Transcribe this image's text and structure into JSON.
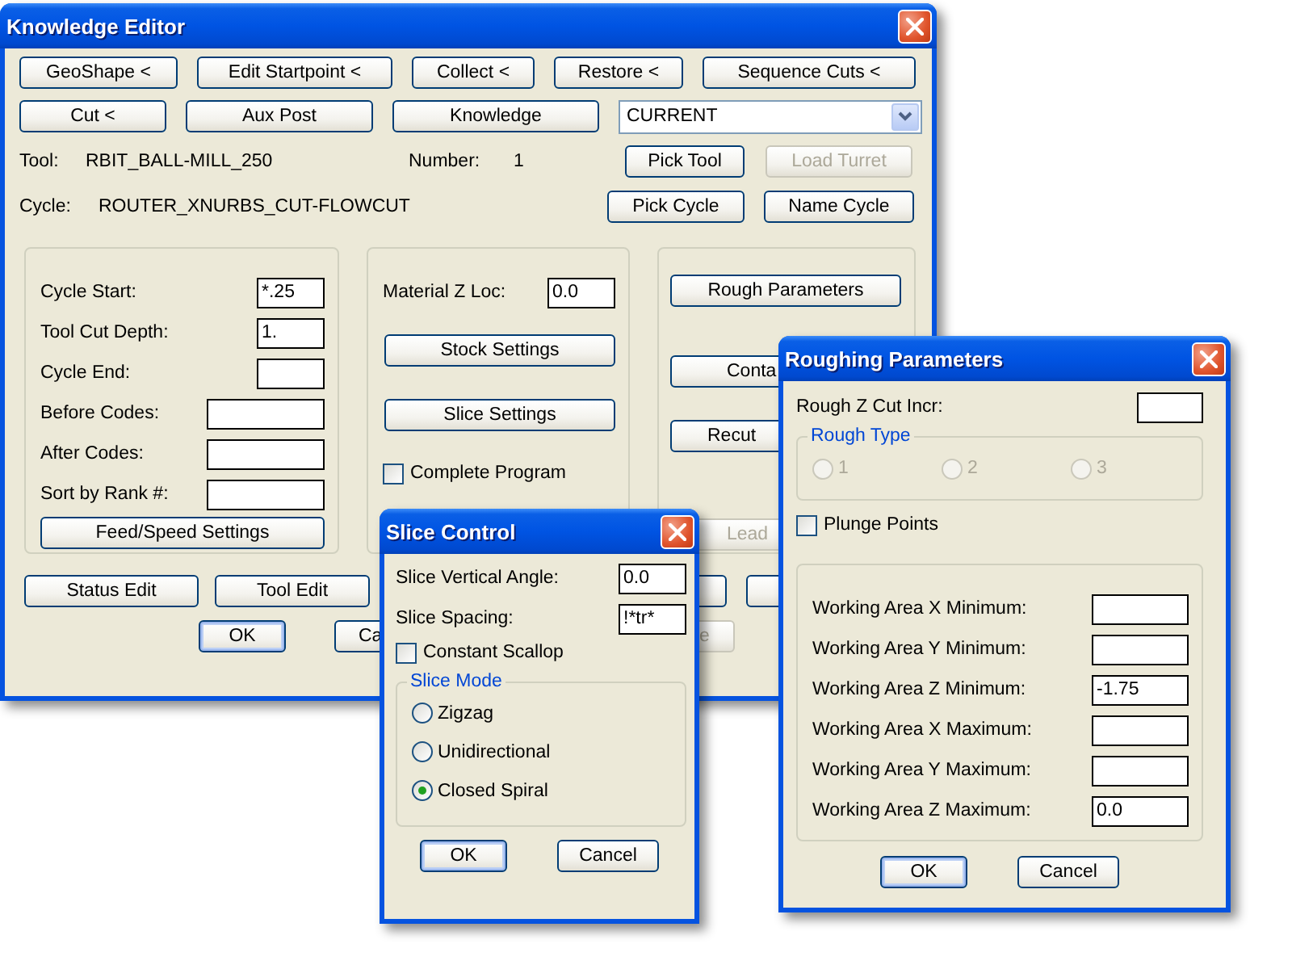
{
  "knowledge_editor": {
    "title": "Knowledge Editor",
    "button_row_1": [
      {
        "label": "GeoShape <"
      },
      {
        "label": "Edit Startpoint <"
      },
      {
        "label": "Collect <"
      },
      {
        "label": "Restore <"
      },
      {
        "label": "Sequence Cuts <"
      }
    ],
    "button_row_2": [
      {
        "label": "Cut <"
      },
      {
        "label": "Aux Post"
      },
      {
        "label": "Knowledge"
      }
    ],
    "mode_dropdown": {
      "value": "CURRENT"
    },
    "tool_row": {
      "label": "Tool:",
      "value": "RBIT_BALL-MILL_250",
      "number_label": "Number:",
      "number": "1",
      "buttons": [
        {
          "label": "Pick Tool",
          "disabled": false
        },
        {
          "label": "Load Turret",
          "disabled": true
        }
      ]
    },
    "cycle_row": {
      "label": "Cycle:",
      "value": "ROUTER_XNURBS_CUT-FLOWCUT",
      "buttons": [
        {
          "label": "Pick Cycle",
          "disabled": false
        },
        {
          "label": "Name Cycle",
          "disabled": false
        }
      ]
    },
    "cycle_fields": [
      {
        "label": "Cycle Start:",
        "value": "*.25"
      },
      {
        "label": "Tool Cut Depth:",
        "value": "1."
      },
      {
        "label": "Cycle End:"
      },
      {
        "label": "Before Codes:"
      },
      {
        "label": "After Codes:"
      },
      {
        "label": "Sort by Rank #:"
      }
    ],
    "feed_speed_button": "Feed/Speed Settings",
    "material_z": {
      "label": "Material Z Loc:",
      "value": "0.0"
    },
    "settings_buttons": [
      "Stock Settings",
      "Slice Settings"
    ],
    "complete_program": {
      "label": "Complete Program",
      "checked": false
    },
    "parameter_buttons": [
      {
        "label": "Rough Parameters",
        "disabled": false
      },
      {
        "label": "Conta",
        "disabled": false
      },
      {
        "label": "Recut",
        "disabled": false
      },
      {
        "label": "Lead",
        "disabled": true
      }
    ],
    "bottom_buttons": [
      {
        "label": "Status Edit"
      },
      {
        "label": "Tool Edit"
      }
    ],
    "dialog_buttons": [
      {
        "label": "OK",
        "default": true,
        "disabled": false
      },
      {
        "label": "Ca",
        "default": false,
        "disabled": false
      },
      {
        "label": "e",
        "default": false,
        "disabled": true
      }
    ]
  },
  "slice_control": {
    "title": "Slice Control",
    "fields": [
      {
        "label": "Slice Vertical Angle:",
        "value": "0.0"
      },
      {
        "label": "Slice Spacing:",
        "value": "!*tr*"
      }
    ],
    "constant_scallop": {
      "label": "Constant Scallop",
      "checked": false
    },
    "mode_group": {
      "title": "Slice Mode",
      "options": [
        {
          "label": "Zigzag",
          "selected": false
        },
        {
          "label": "Unidirectional",
          "selected": false
        },
        {
          "label": "Closed Spiral",
          "selected": true
        }
      ]
    },
    "buttons": [
      {
        "label": "OK",
        "default": true
      },
      {
        "label": "Cancel",
        "default": false
      }
    ]
  },
  "roughing_parameters": {
    "title": "Roughing Parameters",
    "z_cut_incr": {
      "label": "Rough Z Cut Incr:"
    },
    "rough_type": {
      "title": "Rough Type",
      "disabled": true,
      "options": [
        {
          "label": "1",
          "selected": false
        },
        {
          "label": "2",
          "selected": false
        },
        {
          "label": "3",
          "selected": false
        }
      ]
    },
    "plunge_points": {
      "label": "Plunge Points",
      "checked": false
    },
    "working_area": [
      {
        "label": "Working Area X Minimum:"
      },
      {
        "label": "Working Area Y Minimum:"
      },
      {
        "label": "Working Area Z Minimum:",
        "value": "-1.75"
      },
      {
        "label": "Working Area X Maximum:"
      },
      {
        "label": "Working Area Y Maximum:"
      },
      {
        "label": "Working Area Z Maximum:",
        "value": "0.0"
      }
    ],
    "buttons": [
      {
        "label": "OK",
        "default": true
      },
      {
        "label": "Cancel",
        "default": false
      }
    ]
  }
}
